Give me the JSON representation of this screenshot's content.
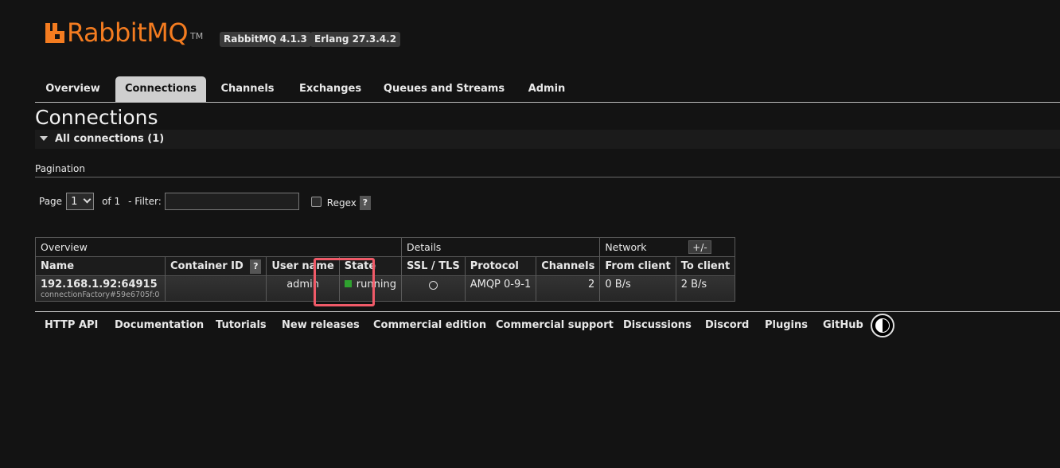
{
  "header": {
    "brand": "RabbitMQ",
    "trademark": "TM",
    "rabbitmq_version": "RabbitMQ 4.1.3",
    "erlang_version": "Erlang 27.3.4.2",
    "brand_color": "#f47c20"
  },
  "tabs": [
    {
      "label": "Overview",
      "active": false
    },
    {
      "label": "Connections",
      "active": true
    },
    {
      "label": "Channels",
      "active": false
    },
    {
      "label": "Exchanges",
      "active": false
    },
    {
      "label": "Queues and Streams",
      "active": false
    },
    {
      "label": "Admin",
      "active": false
    }
  ],
  "page": {
    "title": "Connections",
    "section_title": "All connections (1)"
  },
  "pagination": {
    "heading": "Pagination",
    "page_label": "Page",
    "page_value": "1",
    "of_label": "of 1",
    "filter_label": "- Filter:",
    "filter_value": "",
    "regex_label": "Regex",
    "regex_checked": false,
    "help_label": "?"
  },
  "table": {
    "groups": [
      {
        "label": "Overview",
        "span": 4
      },
      {
        "label": "Details",
        "span": 3
      },
      {
        "label": "Network",
        "span": 2
      }
    ],
    "columns": [
      "Name",
      "Container ID",
      "User name",
      "State",
      "SSL / TLS",
      "Protocol",
      "Channels",
      "From client",
      "To client"
    ],
    "help_label": "?",
    "toggle_columns_label": "+/-",
    "rows": [
      {
        "name": "192.168.1.92:64915",
        "subname": "connectionFactory#59e6705f:0",
        "container_id": "",
        "user": "admin",
        "state": "running",
        "state_color": "#2fa12f",
        "ssl": "",
        "protocol": "AMQP 0-9-1",
        "channels": "2",
        "from_client": "0 B/s",
        "to_client": "2 B/s"
      }
    ]
  },
  "highlight_color": "#f05a68",
  "footer": {
    "links": [
      "HTTP API",
      "Documentation",
      "Tutorials",
      "New releases",
      "Commercial edition",
      "Commercial support",
      "Discussions",
      "Discord",
      "Plugins",
      "GitHub"
    ]
  }
}
